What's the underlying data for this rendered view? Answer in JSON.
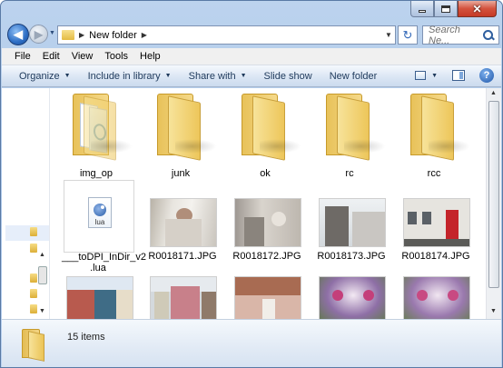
{
  "window": {
    "caption_minimize": "minimize",
    "caption_maximize": "maximize",
    "caption_close": "✕"
  },
  "nav": {
    "back_glyph": "◀",
    "forward_glyph": "▶",
    "breadcrumb": "New folder",
    "separator": "▶",
    "refresh_glyph": "↻"
  },
  "search": {
    "placeholder": "Search Ne..."
  },
  "menu": {
    "items": [
      "File",
      "Edit",
      "View",
      "Tools",
      "Help"
    ]
  },
  "toolbar": {
    "organize": "Organize",
    "include": "Include in library",
    "share": "Share with",
    "slideshow": "Slide show",
    "newfolder": "New folder",
    "arrow": "▼",
    "help": "?"
  },
  "items": [
    {
      "name": "img_op",
      "type": "folder-with-files"
    },
    {
      "name": "junk",
      "type": "folder"
    },
    {
      "name": "ok",
      "type": "folder"
    },
    {
      "name": "rc",
      "type": "folder"
    },
    {
      "name": "rcc",
      "type": "folder"
    },
    {
      "name": "__toDPI_InDir_v2.lua",
      "line1": "___toDPI_InDir_v2",
      "line2": ".lua",
      "ext": "lua",
      "type": "lua-script"
    },
    {
      "name": "R0018171.JPG",
      "type": "photo"
    },
    {
      "name": "R0018172.JPG",
      "type": "photo"
    },
    {
      "name": "R0018173.JPG",
      "type": "photo"
    },
    {
      "name": "R0018174.JPG",
      "type": "photo"
    }
  ],
  "status": {
    "count": "15 items"
  }
}
